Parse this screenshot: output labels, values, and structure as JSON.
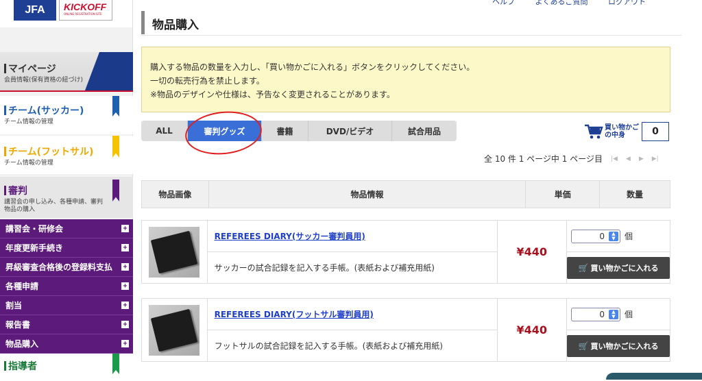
{
  "header": {
    "logo_jfa": "JFA",
    "logo_kickoff": "KICKOFF",
    "logo_kickoff_sub": "ONLINE REGISTRATION SITE",
    "top_links": [
      "ヘルプ",
      "よくあるご質問",
      "ログアウト"
    ]
  },
  "sidebar": {
    "mypage": {
      "title": "マイページ",
      "sub": "会員情報(保有資格の紐づけ)"
    },
    "team": {
      "title": "チーム(サッカー)",
      "sub": "チーム情報の管理"
    },
    "futsal": {
      "title": "チーム(フットサル)",
      "sub": "チーム情報の管理"
    },
    "referee": {
      "title": "審判",
      "sub": "講習会の申し込み、各種申請、審判物品の購入"
    },
    "referee_menu": [
      "講習会・研修会",
      "年度更新手続き",
      "昇級審査合格後の登録料支払",
      "各種申請",
      "割当",
      "報告書",
      "物品購入"
    ],
    "instructor": {
      "title": "指導者"
    }
  },
  "main": {
    "title": "物品購入",
    "notice": [
      "購入する物品の数量を入力し、「買い物かごに入れる」ボタンをクリックしてください。",
      "一切の転売行為を禁止します。",
      "※物品のデザインや仕様は、予告なく変更されることがあります。"
    ],
    "tabs": [
      "ALL",
      "審判グッズ",
      "書籍",
      "DVD/ビデオ",
      "試合用品"
    ],
    "active_tab": "審判グッズ",
    "cart": {
      "label_line1": "買い物かご",
      "label_line2": "の中身",
      "count": "0"
    },
    "pager": {
      "text": "全 10 件 1 ページ中 1 ページ目"
    },
    "table_headers": [
      "物品画像",
      "物品情報",
      "単価",
      "数量"
    ],
    "items": [
      {
        "name": "REFEREES DIARY(サッカー審判員用)",
        "desc": "サッカーの試合記録を記入する手帳。(表紙および補充用紙)",
        "price": "¥440",
        "qty": "0",
        "unit": "個",
        "button": "買い物かごに入れる"
      },
      {
        "name": "REFEREES DIARY(フットサル審判員用)",
        "desc": "フットサルの試合記録を記入する手帳。(表紙および補充用紙)",
        "price": "¥440",
        "qty": "0",
        "unit": "個",
        "button": "買い物かごに入れる"
      }
    ]
  },
  "colors": {
    "brand": "#1f3f95",
    "referee": "#5c1a7a",
    "active_tab": "#3a6fd8",
    "price": "#a8101e",
    "notice_bg": "#fdf8c8"
  }
}
